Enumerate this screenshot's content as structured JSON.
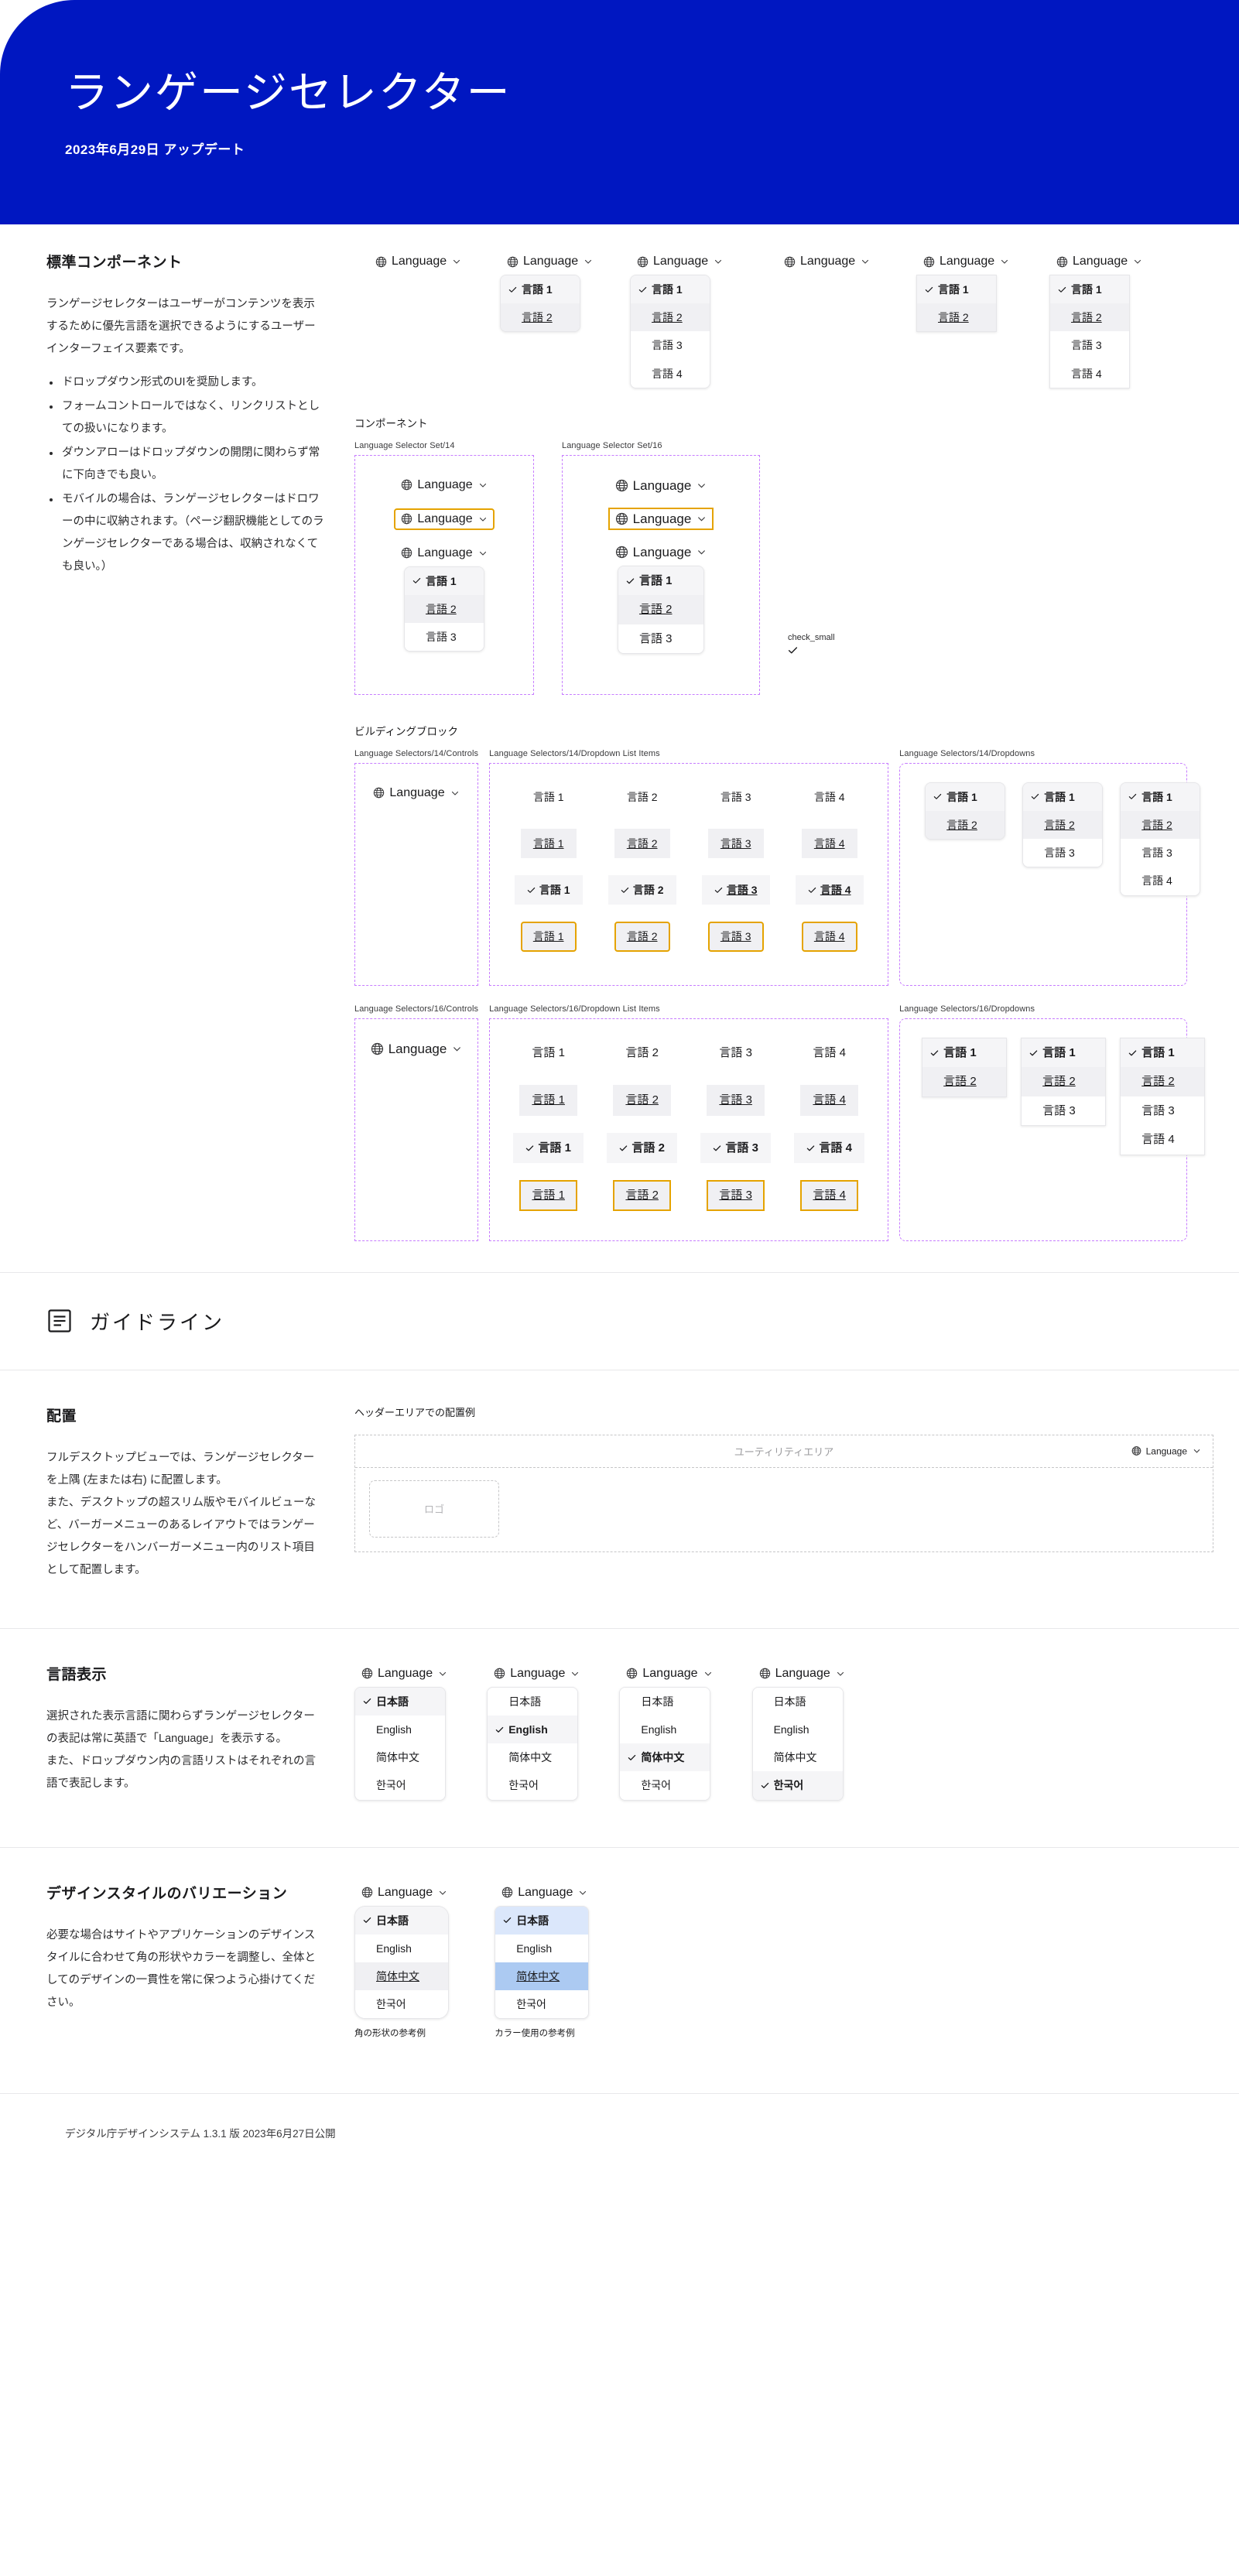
{
  "banner": {
    "title": "ランゲージセレクター",
    "subtitle": "2023年6月29日 アップデート"
  },
  "standard": {
    "heading": "標準コンポーネント",
    "intro": "ランゲージセレクターはユーザーがコンテンツを表示するために優先言語を選択できるようにするユーザーインターフェイス要素です。",
    "bullets": [
      "ドロップダウン形式のUIを奨励します。",
      "フォームコントロールではなく、リンクリストとしての扱いになります。",
      "ダウンアローはドロップダウンの開閉に関わらず常に下向きでも良い。",
      "モバイルの場合は、ランゲージセレクターはドロワーの中に収納されます。（ページ翻訳機能としてのランゲージセレクターである場合は、収納されなくても良い。）"
    ]
  },
  "labels": {
    "language_control": "Language",
    "lang1": "言語 1",
    "lang2": "言語 2",
    "lang3": "言語 3",
    "lang4": "言語 4",
    "globe_icon": "globe-icon",
    "caret_icon": "chevron-down-icon",
    "check_icon": "check-icon"
  },
  "components": {
    "heading": "コンポーネント",
    "set14_label": "Language Selector Set/14",
    "set16_label": "Language Selector Set/16",
    "check_small": "check_small"
  },
  "building_blocks": {
    "heading": "ビルディングブロック",
    "frames": [
      {
        "controls": "Language Selectors/14/Controls",
        "items": "Language Selectors/14/Dropdown List Items",
        "dropdowns": "Language Selectors/14/Dropdowns"
      },
      {
        "controls": "Language Selectors/16/Controls",
        "items": "Language Selectors/16/Dropdown List Items",
        "dropdowns": "Language Selectors/16/Dropdowns"
      }
    ],
    "item_rows": [
      "言語 1",
      "言語 2",
      "言語 3",
      "言語 4"
    ]
  },
  "guideline": {
    "title": "ガイドライン",
    "icon": "document-lines-icon"
  },
  "placement": {
    "heading": "配置",
    "body": "フルデスクトップビューでは、ランゲージセレクターを上隅 (左または右) に配置します。\nまた、デスクトップの超スリム版やモバイルビューなど、バーガーメニューのあるレイアウトではランゲージセレクターをハンバーガーメニュー内のリスト項目として配置します。",
    "example_title": "ヘッダーエリアでの配置例",
    "utility_area": "ユーティリティエリア",
    "logo": "ロゴ"
  },
  "language_display": {
    "heading": "言語表示",
    "body": "選択された表示言語に関わらずランゲージセレクターの表記は常に英語で「Language」を表示する。\nまた、ドロップダウン内の言語リストはそれぞれの言語で表記します。",
    "languages": [
      "日本語",
      "English",
      "简体中文",
      "한국어"
    ],
    "selected_indices": [
      0,
      1,
      2,
      3
    ]
  },
  "design_style": {
    "heading": "デザインスタイルのバリエーション",
    "body": "必要な場合はサイトやアプリケーションのデザインスタイルに合わせて角の形状やカラーを調整し、全体としてのデザインの一貫性を常に保つよう心掛けてください。",
    "languages": [
      "日本語",
      "English",
      "简体中文",
      "한국어"
    ],
    "caption_corner": "角の形状の参考例",
    "caption_color": "カラー使用の参考例"
  },
  "footer": {
    "text": "デジタル庁デザインシステム 1.3.1 版 2023年6月27日公開"
  }
}
